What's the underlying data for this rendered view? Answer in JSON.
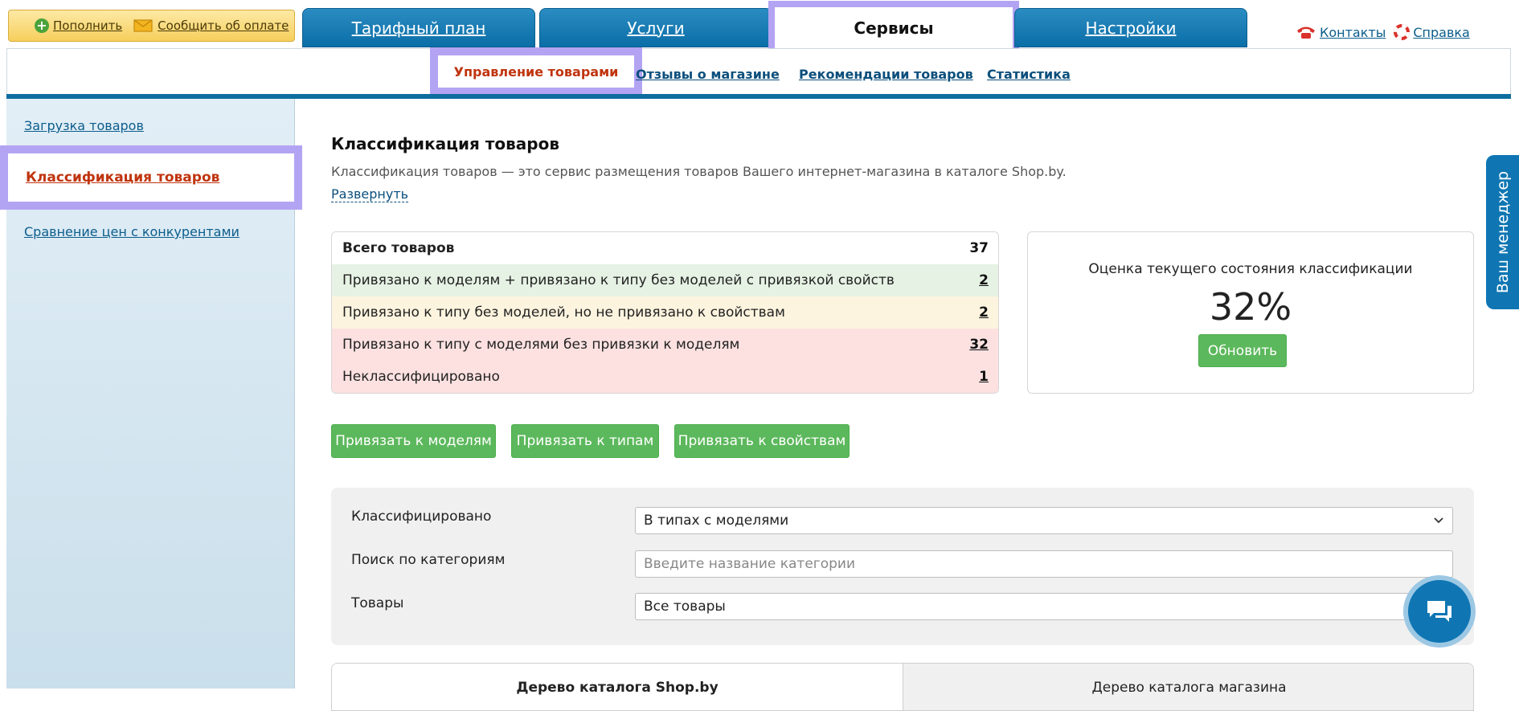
{
  "wallet": {
    "topup": "Пополнить",
    "report_payment": "Сообщить об оплате"
  },
  "tabs": [
    {
      "label": "Тарифный план",
      "active": false
    },
    {
      "label": "Услуги",
      "active": false
    },
    {
      "label": "Сервисы",
      "active": true
    },
    {
      "label": "Настройки",
      "active": false
    }
  ],
  "toplinks": {
    "contacts": "Контакты",
    "help": "Справка"
  },
  "subnav": [
    {
      "label": "Управление товарами",
      "active": true
    },
    {
      "label": "Отзывы о магазине",
      "active": false
    },
    {
      "label": "Рекомендации товаров",
      "active": false
    },
    {
      "label": "Статистика",
      "active": false
    }
  ],
  "sidebar": [
    {
      "label": "Загрузка товаров",
      "active": false
    },
    {
      "label": "Классификация товаров",
      "active": true
    },
    {
      "label": "Сравнение цен с конкурентами",
      "active": false
    }
  ],
  "main": {
    "title": "Классификация товаров",
    "description": "Классификация товаров — это сервис размещения товаров Вашего интернет-магазина в каталоге Shop.by.",
    "expand": "Развернуть"
  },
  "stats": [
    {
      "label": "Всего товаров",
      "value": "37",
      "status": "total"
    },
    {
      "label": "Привязано к моделям + привязано к типу без моделей с привязкой свойств",
      "value": "2",
      "status": "green"
    },
    {
      "label": "Привязано к типу без моделей, но не привязано к свойствам",
      "value": "2",
      "status": "yellow"
    },
    {
      "label": "Привязано к типу с моделями без привязки к моделям",
      "value": "32",
      "status": "red"
    },
    {
      "label": "Неклассифицировано",
      "value": "1",
      "status": "red"
    }
  ],
  "score": {
    "title": "Оценка текущего состояния классификации",
    "value": "32%",
    "refresh": "Обновить"
  },
  "actions": {
    "bind_models": "Привязать к моделям",
    "bind_types": "Привязать к типам",
    "bind_props": "Привязать к свойствам"
  },
  "filters": {
    "classified_label": "Классифицировано",
    "classified_value": "В типах с моделями",
    "category_label": "Поиск по категориям",
    "category_placeholder": "Введите название категории",
    "goods_label": "Товары",
    "goods_value": "Все товары"
  },
  "tree_tabs": {
    "shop_by": "Дерево каталога Shop.by",
    "store": "Дерево каталога магазина"
  },
  "manager": {
    "label": "Ваш менеджер"
  },
  "colors": {
    "brand_blue": "#0f76b3",
    "accent_green": "#5cb85c",
    "active_red": "#c0340e",
    "highlight": "#b3a4f3"
  }
}
